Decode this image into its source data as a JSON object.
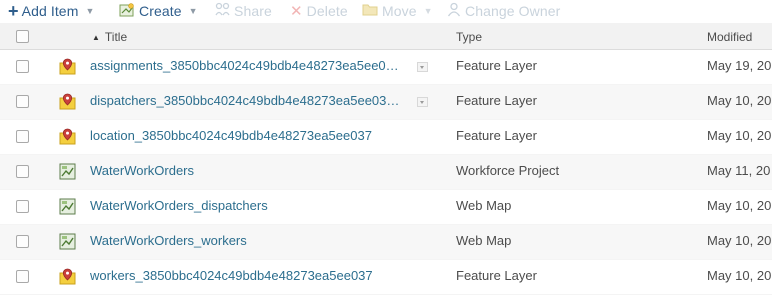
{
  "toolbar": {
    "add_item": "Add Item",
    "create": "Create",
    "share": "Share",
    "delete": "Delete",
    "move": "Move",
    "change_owner": "Change Owner"
  },
  "columns": {
    "title": "Title",
    "type": "Type",
    "modified": "Modified"
  },
  "rows": [
    {
      "title": "assignments_3850bbc4024c49bdb4e48273ea5ee0…",
      "type": "Feature Layer",
      "modified": "May 19, 20",
      "icon": "feature-layer-icon"
    },
    {
      "title": "dispatchers_3850bbc4024c49bdb4e48273ea5ee03…",
      "type": "Feature Layer",
      "modified": "May 10, 20",
      "icon": "feature-layer-icon"
    },
    {
      "title": "location_3850bbc4024c49bdb4e48273ea5ee037",
      "type": "Feature Layer",
      "modified": "May 10, 20",
      "icon": "feature-layer-icon"
    },
    {
      "title": "WaterWorkOrders",
      "type": "Workforce Project",
      "modified": "May 11, 20",
      "icon": "map-document-icon"
    },
    {
      "title": "WaterWorkOrders_dispatchers",
      "type": "Web Map",
      "modified": "May 10, 20",
      "icon": "web-map-icon"
    },
    {
      "title": "WaterWorkOrders_workers",
      "type": "Web Map",
      "modified": "May 10, 20",
      "icon": "web-map-icon"
    },
    {
      "title": "workers_3850bbc4024c49bdb4e48273ea5ee037",
      "type": "Feature Layer",
      "modified": "May 10, 20",
      "icon": "feature-layer-icon"
    }
  ],
  "colors": {
    "link": "#2c6e8e",
    "toolbar_active": "#2f5e8c",
    "toolbar_disabled": "#c9d3dc"
  }
}
